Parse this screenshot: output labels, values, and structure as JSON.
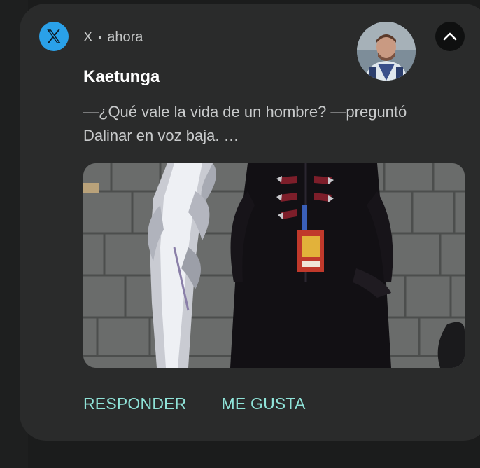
{
  "notification": {
    "app_name": "X",
    "separator": "•",
    "time": "ahora",
    "app_icon": "x-logo-icon",
    "sender": "Kaetunga",
    "message": "—¿Qué vale la vida de un hombre? —preguntó Dalinar en voz baja. …",
    "collapse_icon": "chevron-up-icon",
    "actions": {
      "reply": "RESPONDER",
      "like": "ME GUSTA"
    }
  },
  "colors": {
    "card_bg": "#2a2b2b",
    "app_icon_bg": "#2aa1e9",
    "action_text": "#8fe3d8",
    "title": "#ffffff"
  }
}
